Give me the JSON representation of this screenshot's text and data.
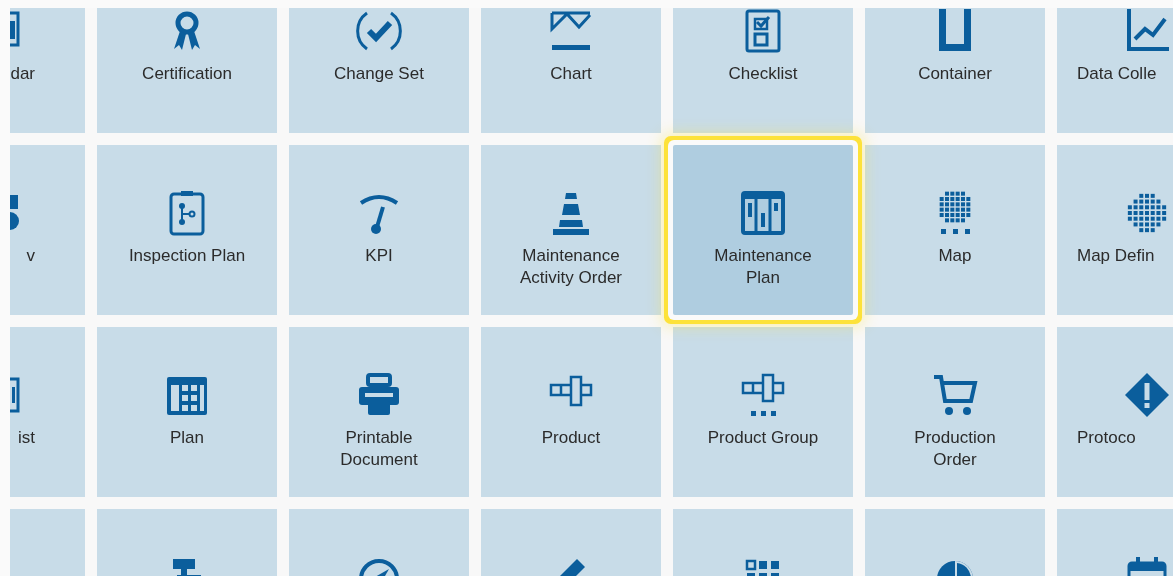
{
  "tiles": [
    {
      "label": "dar",
      "selected": false
    },
    {
      "label": "Certification",
      "selected": false
    },
    {
      "label": "Change Set",
      "selected": false
    },
    {
      "label": "Chart",
      "selected": false
    },
    {
      "label": "Checklist",
      "selected": false
    },
    {
      "label": "Container",
      "selected": false
    },
    {
      "label": "Data Colle",
      "selected": false
    },
    {
      "label": "v",
      "selected": false
    },
    {
      "label": "Inspection Plan",
      "selected": false
    },
    {
      "label": "KPI",
      "selected": false
    },
    {
      "label": "Maintenance Activity Order",
      "selected": false
    },
    {
      "label": "Maintenance Plan",
      "selected": true
    },
    {
      "label": "Map",
      "selected": false
    },
    {
      "label": "Map Defin",
      "selected": false
    },
    {
      "label": "ist",
      "selected": false
    },
    {
      "label": "Plan",
      "selected": false
    },
    {
      "label": "Printable Document",
      "selected": false
    },
    {
      "label": "Product",
      "selected": false
    },
    {
      "label": "Product Group",
      "selected": false
    },
    {
      "label": "Production Order",
      "selected": false
    },
    {
      "label": "Protoco",
      "selected": false
    },
    {
      "selected": false
    },
    {
      "selected": false
    },
    {
      "selected": false
    },
    {
      "selected": false
    },
    {
      "selected": false
    },
    {
      "selected": false
    },
    {
      "selected": false
    }
  ]
}
